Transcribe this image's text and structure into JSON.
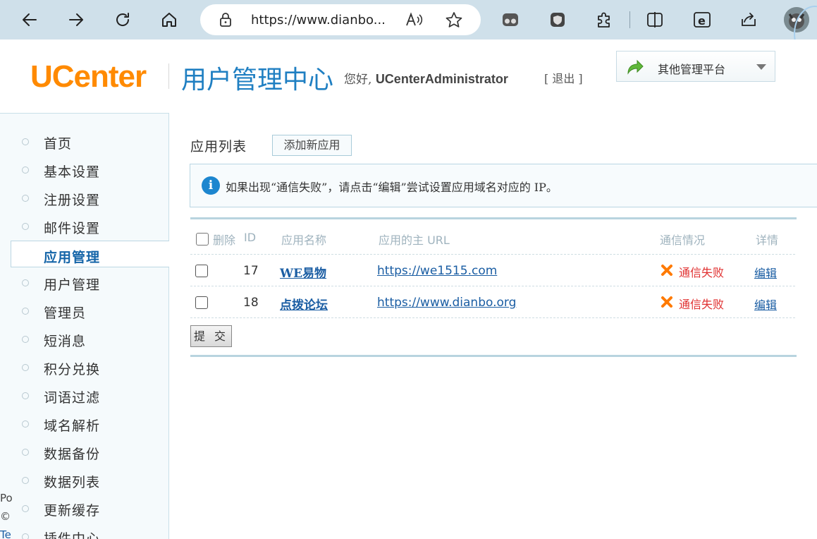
{
  "browser": {
    "url": "https://www.dianbo...",
    "icons": [
      "back-icon",
      "forward-icon",
      "refresh-icon",
      "home-icon",
      "lock-icon",
      "read-aloud-icon",
      "favorite-star-icon",
      "extension-icon",
      "shield-icon",
      "puzzle-icon",
      "split-screen-icon",
      "ie-mode-icon",
      "share-icon",
      "profile-avatar"
    ]
  },
  "header": {
    "logo": "UCenter",
    "title": "用户管理中心",
    "greeting_prefix": "您好,",
    "username": "UCenterAdministrator",
    "logout": "[ 退出 ]",
    "platform_select": "其他管理平台"
  },
  "sidebar": {
    "items": [
      {
        "label": "首页"
      },
      {
        "label": "基本设置"
      },
      {
        "label": "注册设置"
      },
      {
        "label": "邮件设置"
      },
      {
        "label": "应用管理"
      },
      {
        "label": "用户管理"
      },
      {
        "label": "管理员"
      },
      {
        "label": "短消息"
      },
      {
        "label": "积分兑换"
      },
      {
        "label": "词语过滤"
      },
      {
        "label": "域名解析"
      },
      {
        "label": "数据备份"
      },
      {
        "label": "数据列表"
      },
      {
        "label": "更新缓存"
      },
      {
        "label": "插件中心"
      }
    ],
    "active_index": 4,
    "footer_fragments": [
      "Po",
      "©",
      "Te"
    ]
  },
  "main": {
    "section_title": "应用列表",
    "add_button": "添加新应用",
    "notice": "如果出现“通信失败”，请点击“编辑”尝试设置应用域名对应的 IP。",
    "table": {
      "headers": {
        "delete": "删除",
        "id": "ID",
        "name": "应用名称",
        "url": "应用的主 URL",
        "status": "通信情况",
        "detail": "详情"
      },
      "rows": [
        {
          "id": "17",
          "name": "WE易物",
          "url": "https://we1515.com",
          "status": "通信失败",
          "edit": "编辑"
        },
        {
          "id": "18",
          "name": "点拨论坛",
          "url": "https://www.dianbo.org",
          "status": "通信失败",
          "edit": "编辑"
        }
      ]
    },
    "submit_button": "提 交"
  },
  "colors": {
    "logo_orange": "#ff8a00",
    "title_blue": "#1f7fc2",
    "link_blue": "#1a5da3",
    "fail_red": "#e03030",
    "fail_icon_orange": "#ff7a00",
    "browser_bar": "#cfe0ea"
  }
}
